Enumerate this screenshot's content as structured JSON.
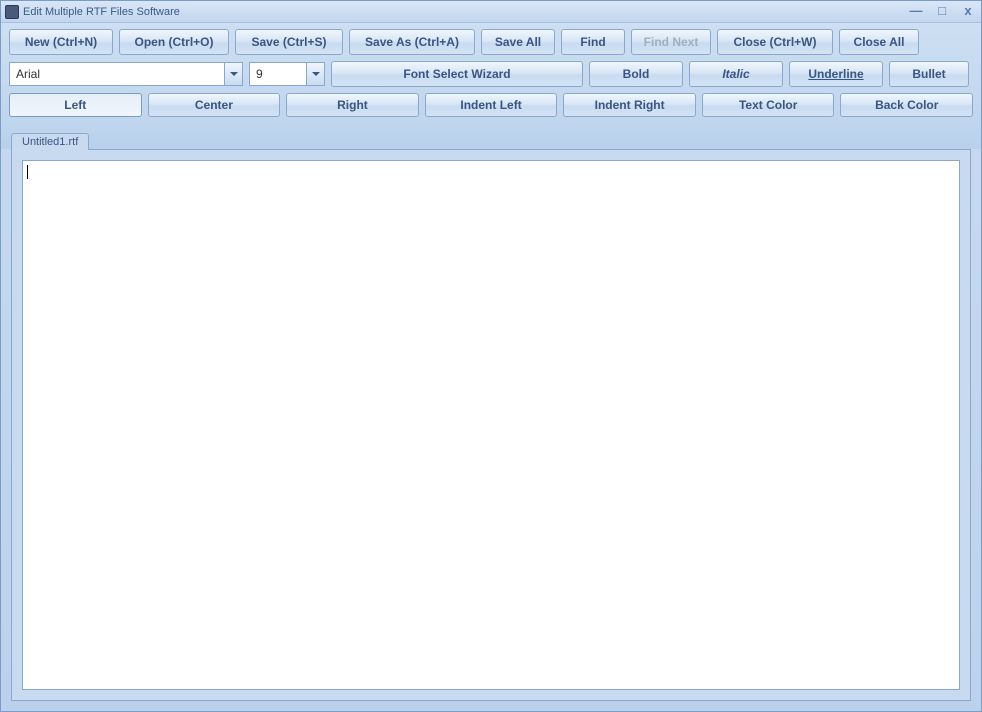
{
  "window": {
    "title": "Edit Multiple RTF Files Software"
  },
  "toolbar1": {
    "new": "New (Ctrl+N)",
    "open": "Open (Ctrl+O)",
    "save": "Save (Ctrl+S)",
    "saveas": "Save As (Ctrl+A)",
    "saveall": "Save All",
    "find": "Find",
    "findnext": "Find Next",
    "close": "Close (Ctrl+W)",
    "closeall": "Close All"
  },
  "toolbar2": {
    "font_name": "Arial",
    "font_size": "9",
    "wizard": "Font Select Wizard",
    "bold": "Bold",
    "italic": "Italic",
    "underline": "Underline",
    "bullet": "Bullet"
  },
  "toolbar3": {
    "left": "Left",
    "center": "Center",
    "right": "Right",
    "indentleft": "Indent Left",
    "indentright": "Indent Right",
    "textcolor": "Text Color",
    "backcolor": "Back Color"
  },
  "tabs": [
    {
      "label": "Untitled1.rtf"
    }
  ],
  "editor": {
    "content": ""
  }
}
